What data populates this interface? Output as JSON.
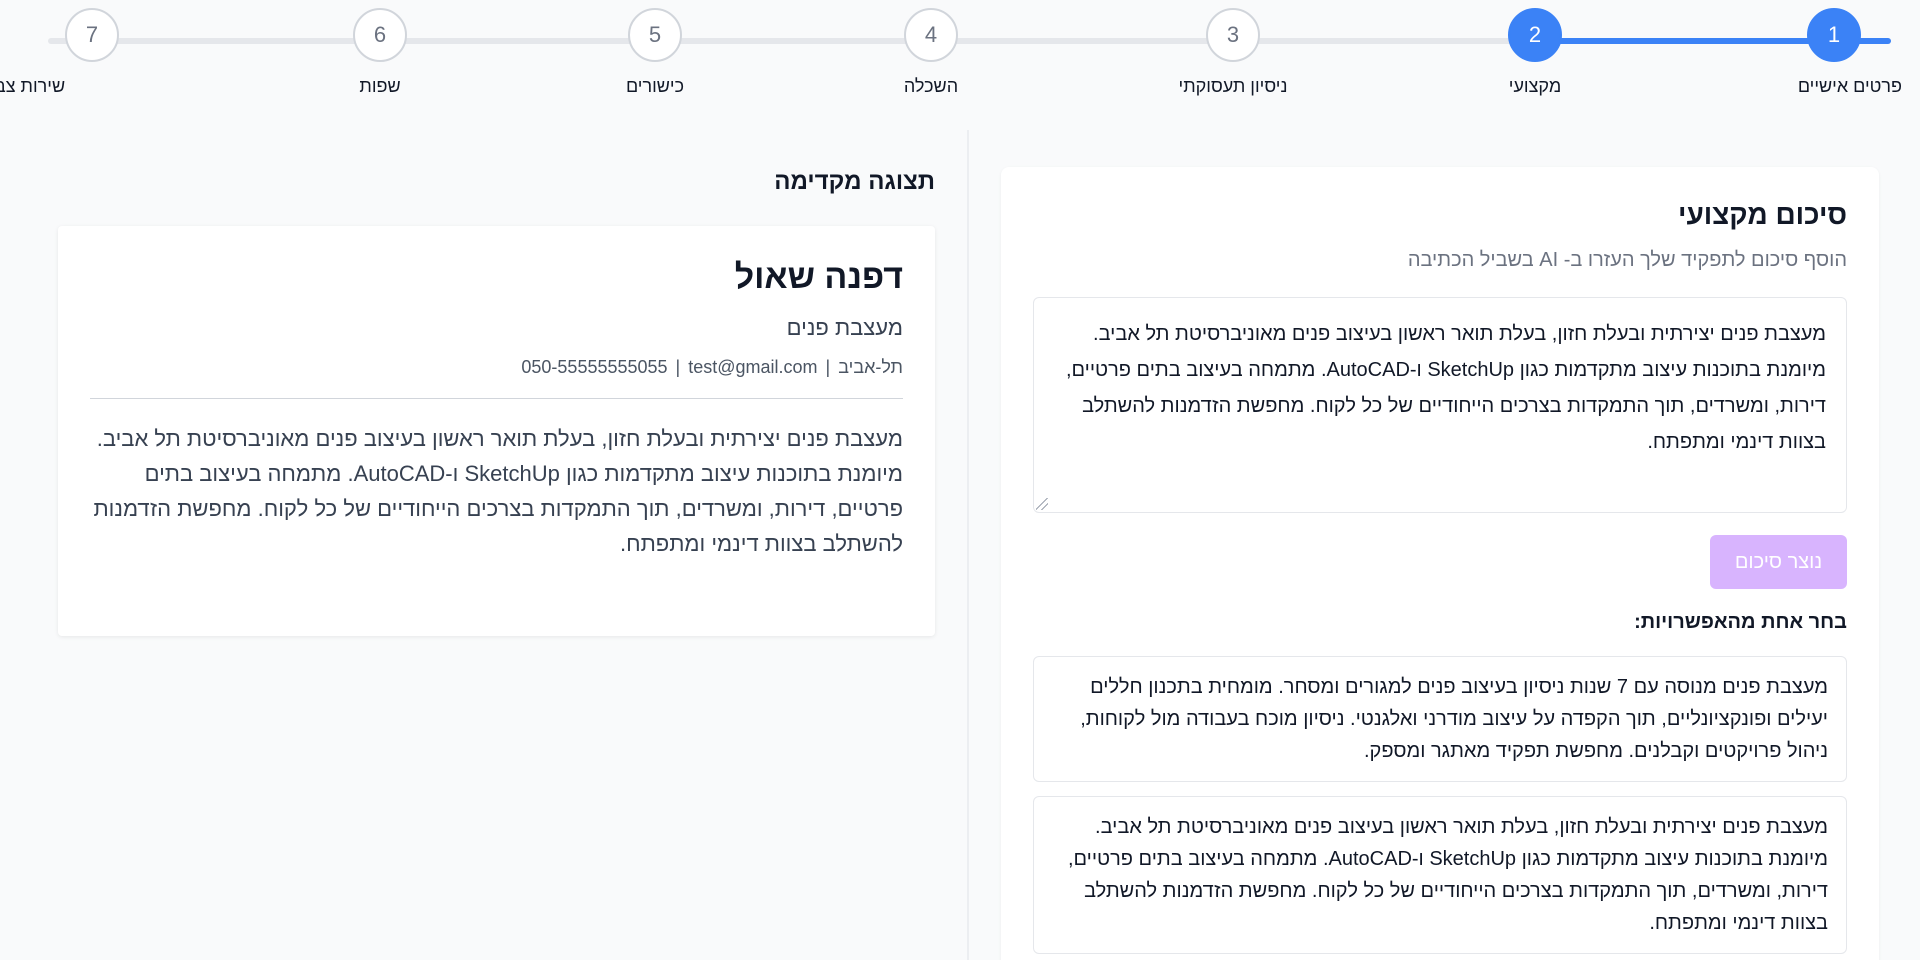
{
  "stepper": {
    "steps": [
      {
        "number": "1",
        "label": "פרטים אישיים"
      },
      {
        "number": "2",
        "label": "מקצועי"
      },
      {
        "number": "3",
        "label": "ניסיון תעסוקתי"
      },
      {
        "number": "4",
        "label": "השכלה"
      },
      {
        "number": "5",
        "label": "כישורים"
      },
      {
        "number": "6",
        "label": "שפות"
      },
      {
        "number": "7",
        "label": "שירות צבאי"
      }
    ],
    "current_step": 2
  },
  "form": {
    "title": "סיכום מקצועי",
    "subtitle": "הוסף סיכום לתפקיד שלך העזרו ב- AI בשביל הכתיבה",
    "summary_text": "מעצבת פנים יצירתית ובעלת חזון, בעלת תואר ראשון בעיצוב פנים מאוניברסיטת תל אביב. מיומנת בתוכנות עיצוב מתקדמות כגון SketchUp ו-AutoCAD. מתמחה בעיצוב בתים פרטיים, דירות, ומשרדים, תוך התמקדות בצרכים הייחודיים של כל לקוח. מחפשת הזדמנות להשתלב בצוות דינמי ומתפתח.",
    "generate_button": "נוצר סיכום",
    "options_title": "בחר אחת מהאפשרויות:",
    "options": [
      "מעצבת פנים מנוסה עם 7 שנות ניסיון בעיצוב פנים למגורים ומסחר. מומחית בתכנון חללים יעילים ופונקציונליים, תוך הקפדה על עיצוב מודרני ואלגנטי. ניסיון מוכח בעבודה מול לקוחות, ניהול פרויקטים וקבלנים. מחפשת תפקיד מאתגר ומספק.",
      "מעצבת פנים יצירתית ובעלת חזון, בעלת תואר ראשון בעיצוב פנים מאוניברסיטת תל אביב. מיומנת בתוכנות עיצוב מתקדמות כגון SketchUp ו-AutoCAD. מתמחה בעיצוב בתים פרטיים, דירות, ומשרדים, תוך התמקדות בצרכים הייחודיים של כל לקוח. מחפשת הזדמנות להשתלב בצוות דינמי ומתפתח."
    ]
  },
  "preview": {
    "title": "תצוגה מקדימה",
    "name": "דפנה שאול",
    "role": "מעצבת פנים",
    "city": "תל-אביב",
    "email": "test@gmail.com",
    "phone": "050-55555555055",
    "separator": "|",
    "summary": "מעצבת פנים יצירתית ובעלת חזון, בעלת תואר ראשון בעיצוב פנים מאוניברסיטת תל אביב. מיומנת בתוכנות עיצוב מתקדמות כגון SketchUp ו-AutoCAD. מתמחה בעיצוב בתים פרטיים, דירות, ומשרדים, תוך התמקדות בצרכים הייחודיים של כל לקוח. מחפשת הזדמנות להשתלב בצוות דינמי ומתפתח."
  },
  "colors": {
    "accent": "#3b82f6",
    "button_disabled": "#d8b4fe",
    "inactive_line": "#e5e7eb"
  }
}
